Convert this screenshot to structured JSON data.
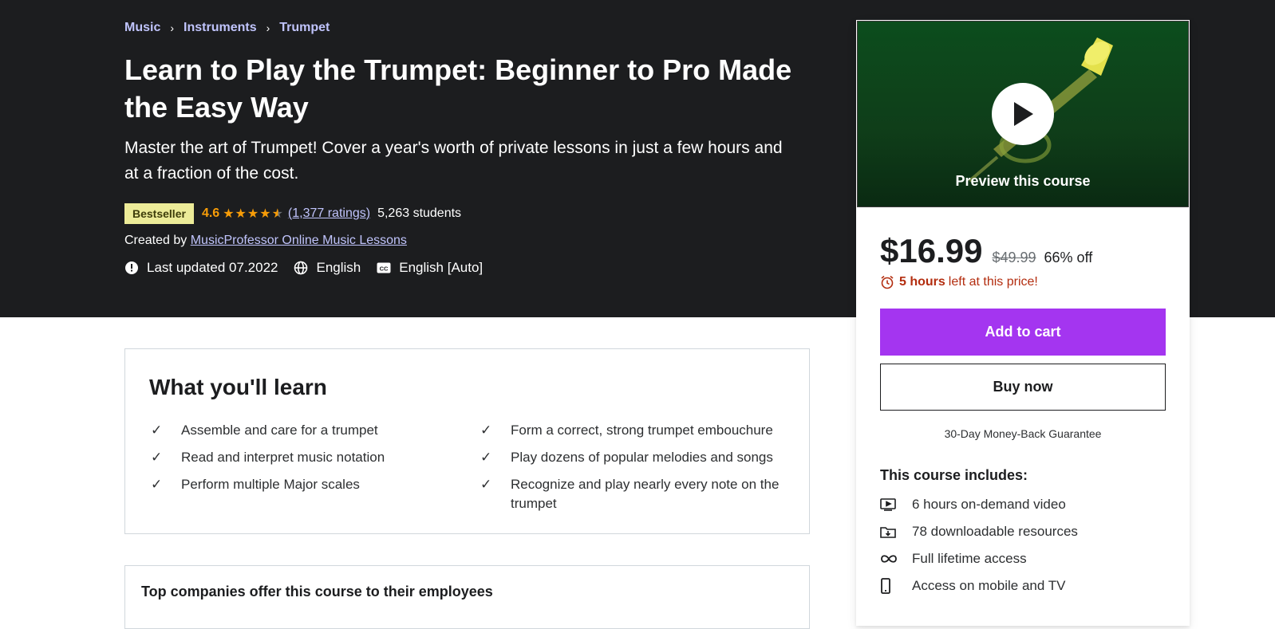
{
  "breadcrumb": [
    "Music",
    "Instruments",
    "Trumpet"
  ],
  "course": {
    "title": "Learn to Play the Trumpet: Beginner to Pro Made the Easy Way",
    "subtitle": "Master the art of Trumpet! Cover a year's worth of private lessons in just a few hours and at a fraction of the cost.",
    "badge": "Bestseller",
    "rating": "4.6",
    "rating_stars": 4.6,
    "ratings_count": "(1,377 ratings)",
    "students": "5,263 students",
    "created_by_label": "Created by",
    "instructor": "MusicProfessor Online Music Lessons",
    "last_updated": "Last updated 07.2022",
    "language": "English",
    "captions": "English [Auto]"
  },
  "learn": {
    "title": "What you'll learn",
    "items": [
      "Assemble and care for a trumpet",
      "Form a correct, strong trumpet embouchure",
      "Read and interpret music notation",
      "Play dozens of popular melodies and songs",
      "Perform multiple Major scales",
      "Recognize and play nearly every note on the trumpet"
    ]
  },
  "companies": {
    "title": "Top companies offer this course to their employees"
  },
  "sidebar": {
    "preview_label": "Preview this course",
    "price": "$16.99",
    "original_price": "$49.99",
    "discount": "66% off",
    "timer_bold": "5 hours",
    "timer_rest": "left at this price!",
    "add_to_cart": "Add to cart",
    "buy_now": "Buy now",
    "guarantee": "30-Day Money-Back Guarantee",
    "includes_title": "This course includes:",
    "includes": [
      {
        "icon": "video-icon",
        "label": "6 hours on-demand video"
      },
      {
        "icon": "download-icon",
        "label": "78 downloadable resources"
      },
      {
        "icon": "infinity-icon",
        "label": "Full lifetime access"
      },
      {
        "icon": "mobile-icon",
        "label": "Access on mobile and TV"
      }
    ]
  },
  "colors": {
    "accent": "#a435f0",
    "link": "#c0c4fc",
    "star": "#f69c08",
    "badge_bg": "#eceb98",
    "timer": "#b32d0f"
  }
}
